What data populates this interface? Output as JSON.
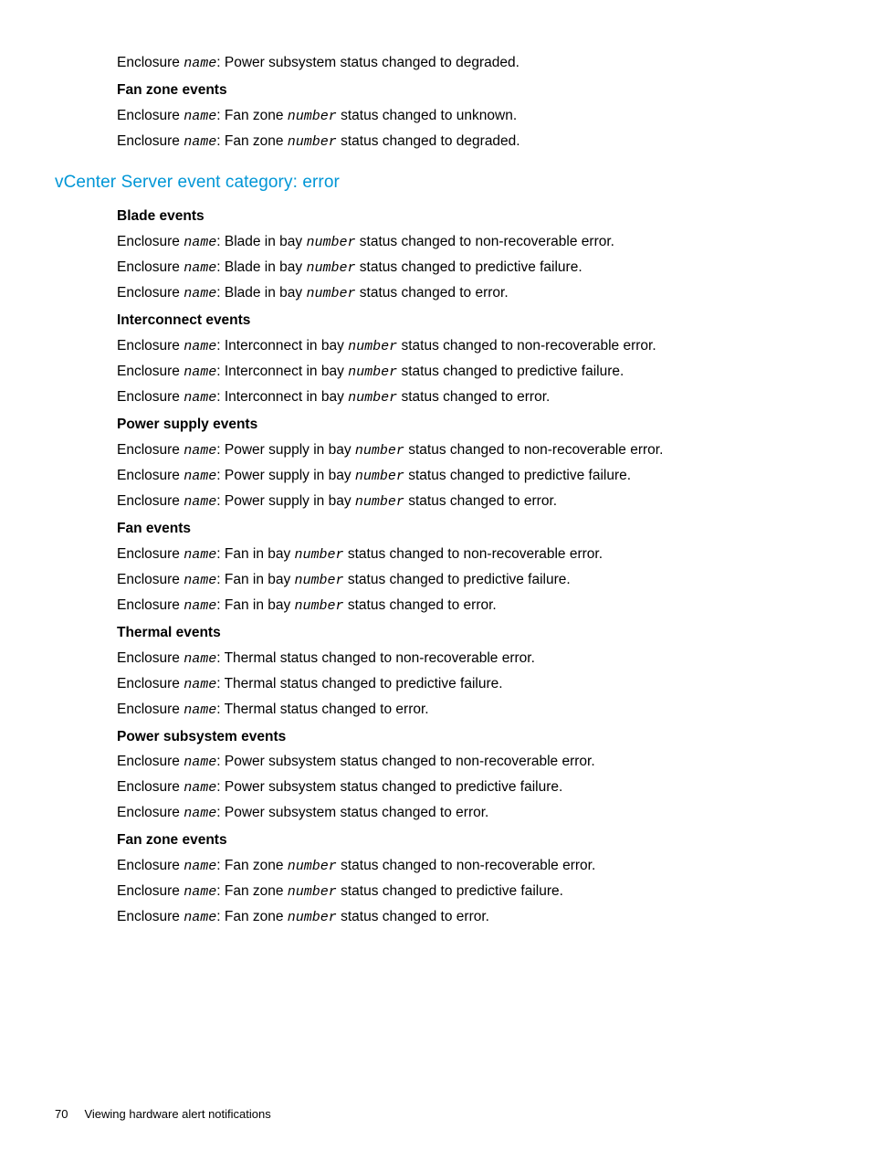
{
  "top": {
    "line1_a": "Enclosure ",
    "line1_b": "name",
    "line1_c": ": Power subsystem status changed to degraded.",
    "h1": "Fan zone events",
    "line2_a": "Enclosure ",
    "line2_b": "name",
    "line2_c": ": Fan zone ",
    "line2_d": "number",
    "line2_e": " status changed to unknown.",
    "line3_a": "Enclosure ",
    "line3_b": "name",
    "line3_c": ": Fan zone ",
    "line3_d": "number",
    "line3_e": " status changed to degraded."
  },
  "section_heading": "vCenter Server event category: error",
  "blade": {
    "h": "Blade events",
    "l1a": "Enclosure ",
    "l1b": "name",
    "l1c": ": Blade in bay ",
    "l1d": "number",
    "l1e": " status changed to non-recoverable error.",
    "l2a": "Enclosure ",
    "l2b": "name",
    "l2c": ": Blade in bay ",
    "l2d": "number",
    "l2e": " status changed to predictive failure.",
    "l3a": "Enclosure ",
    "l3b": "name",
    "l3c": ": Blade in bay ",
    "l3d": "number",
    "l3e": " status changed to error."
  },
  "interconnect": {
    "h": "Interconnect events",
    "l1a": "Enclosure ",
    "l1b": "name",
    "l1c": ": Interconnect in bay ",
    "l1d": "number",
    "l1e": " status changed to non-recoverable error.",
    "l2a": "Enclosure ",
    "l2b": "name",
    "l2c": ": Interconnect in bay ",
    "l2d": "number",
    "l2e": " status changed to predictive failure.",
    "l3a": "Enclosure ",
    "l3b": "name",
    "l3c": ": Interconnect in bay ",
    "l3d": "number",
    "l3e": " status changed to error."
  },
  "powersupply": {
    "h": "Power supply events",
    "l1a": "Enclosure ",
    "l1b": "name",
    "l1c": ": Power supply in bay ",
    "l1d": "number",
    "l1e": " status changed to non-recoverable error.",
    "l2a": "Enclosure ",
    "l2b": "name",
    "l2c": ": Power supply in bay ",
    "l2d": "number",
    "l2e": " status changed to predictive failure.",
    "l3a": "Enclosure ",
    "l3b": "name",
    "l3c": ": Power supply in bay ",
    "l3d": "number",
    "l3e": " status changed to error."
  },
  "fan": {
    "h": "Fan events",
    "l1a": "Enclosure ",
    "l1b": "name",
    "l1c": ": Fan in bay ",
    "l1d": "number",
    "l1e": " status changed to non-recoverable error.",
    "l2a": "Enclosure ",
    "l2b": "name",
    "l2c": ": Fan in bay ",
    "l2d": "number",
    "l2e": " status changed to predictive failure.",
    "l3a": "Enclosure ",
    "l3b": "name",
    "l3c": ": Fan in bay ",
    "l3d": "number",
    "l3e": " status changed to error."
  },
  "thermal": {
    "h": "Thermal events",
    "l1a": "Enclosure ",
    "l1b": "name",
    "l1c": ": Thermal status changed to non-recoverable error.",
    "l2a": "Enclosure ",
    "l2b": "name",
    "l2c": ": Thermal status changed to predictive failure.",
    "l3a": "Enclosure ",
    "l3b": "name",
    "l3c": ": Thermal status changed to error."
  },
  "powersub": {
    "h": "Power subsystem events",
    "l1a": "Enclosure ",
    "l1b": "name",
    "l1c": ": Power subsystem status changed to non-recoverable error.",
    "l2a": "Enclosure ",
    "l2b": "name",
    "l2c": ": Power subsystem status changed to predictive failure.",
    "l3a": "Enclosure ",
    "l3b": "name",
    "l3c": ": Power subsystem status changed to error."
  },
  "fanzone": {
    "h": "Fan zone events",
    "l1a": "Enclosure ",
    "l1b": "name",
    "l1c": ": Fan zone ",
    "l1d": "number",
    "l1e": " status changed to non-recoverable error.",
    "l2a": "Enclosure ",
    "l2b": "name",
    "l2c": ": Fan zone ",
    "l2d": "number",
    "l2e": " status changed to predictive failure.",
    "l3a": "Enclosure ",
    "l3b": "name",
    "l3c": ": Fan zone ",
    "l3d": "number",
    "l3e": " status changed to error."
  },
  "footer": {
    "page": "70",
    "title": "Viewing hardware alert notifications"
  }
}
